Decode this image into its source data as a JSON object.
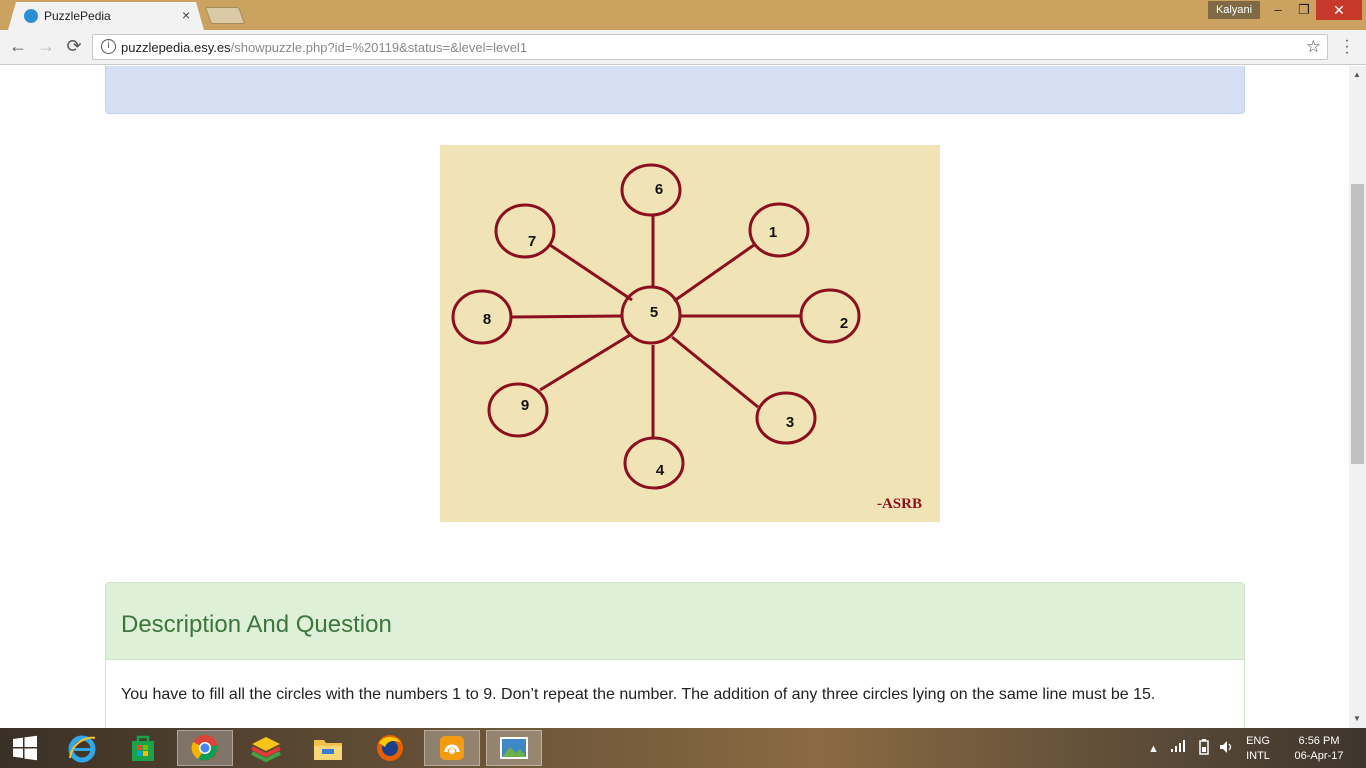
{
  "browser": {
    "tab_title": "PuzzlePedia",
    "tab_close": "×",
    "user": "Kalyani",
    "window_controls": {
      "minimize": "–",
      "restore": "❐",
      "close": "✕"
    },
    "url_host": "puzzlepedia.esy.es",
    "url_path": "/showpuzzle.php?id=%20119&status=&level=level1",
    "back_icon": "←",
    "forward_icon": "→",
    "reload_icon": "⟳",
    "star_icon": "☆"
  },
  "puzzle": {
    "center": "5",
    "outer": [
      "6",
      "1",
      "2",
      "3",
      "4",
      "9",
      "8",
      "7"
    ],
    "signature": "-ASRB",
    "colors": {
      "background": "#f0e4b6",
      "stroke": "#8b0f1f"
    }
  },
  "description": {
    "heading": "Description And Question",
    "text": "You have to fill all the circles with the numbers 1 to 9. Don’t repeat the number. The addition of any three circles lying on the same line must be 15."
  },
  "taskbar": {
    "lang_top": "ENG",
    "lang_bottom": "INTL",
    "time": "6:56 PM",
    "date": "06-Apr-17"
  }
}
